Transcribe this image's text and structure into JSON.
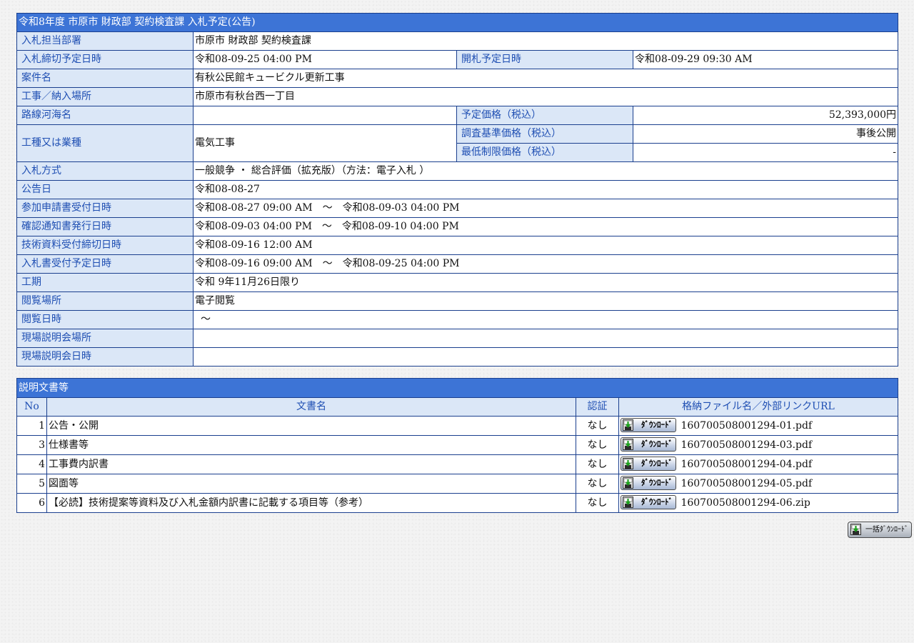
{
  "notice": {
    "title": "令和8年度 市原市 財政部 契約検査課 入札予定(公告)",
    "dept_label": "入札担当部署",
    "dept": "市原市 財政部 契約検査課",
    "deadline_label": "入札締切予定日時",
    "deadline": "令和08-09-25 04:00 PM",
    "opening_label": "開札予定日時",
    "opening": "令和08-09-29 09:30 AM",
    "case_label": "案件名",
    "case": "有秋公民館キュービクル更新工事",
    "place_label": "工事／納入場所",
    "place": "市原市有秋台西一丁目",
    "route_label": "路線河海名",
    "route": "",
    "price_label": "予定価格（税込）",
    "price": "52,393,000円",
    "type_label": "工種又は業種",
    "type": "電気工事",
    "survey_label": "調査基準価格（税込）",
    "survey": "事後公開",
    "min_label": "最低制限価格（税込）",
    "min": "-",
    "method_label": "入札方式",
    "method": "一般競争 ・ 総合評価（拡充版）（方法：電子入札 ）",
    "pubdate_label": "公告日",
    "pubdate": "令和08-08-27",
    "apply_label": "参加申請書受付日時",
    "apply": "令和08-08-27 09:00 AM　～　令和08-09-03 04:00 PM",
    "confirm_label": "確認通知書発行日時",
    "confirm": "令和08-09-03 04:00 PM　～　令和08-09-10 04:00 PM",
    "tech_label": "技術資料受付締切日時",
    "tech": "令和08-09-16 12:00 AM",
    "bidrecv_label": "入札書受付予定日時",
    "bidrecv": "令和08-09-16 09:00 AM　～　令和08-09-25 04:00 PM",
    "period_label": "工期",
    "period": "令和 9年11月26日限り",
    "view_place_label": "閲覧場所",
    "view_place": "電子閲覧",
    "view_date_label": "閲覧日時",
    "view_date": "～",
    "site_place_label": "現場説明会場所",
    "site_place": "",
    "site_date_label": "現場説明会日時",
    "site_date": ""
  },
  "docs": {
    "title": "説明文書等",
    "headers": {
      "no": "No",
      "name": "文書名",
      "auth": "認証",
      "file": "格納ファイル名／外部リンクURL"
    },
    "download_label": "ﾀﾞｳﾝﾛｰﾄﾞ",
    "rows": [
      {
        "no": "1",
        "name": "公告・公開",
        "auth": "なし",
        "file": "160700508001294-01.pdf"
      },
      {
        "no": "3",
        "name": "仕様書等",
        "auth": "なし",
        "file": "160700508001294-03.pdf"
      },
      {
        "no": "4",
        "name": "工事費内訳書",
        "auth": "なし",
        "file": "160700508001294-04.pdf"
      },
      {
        "no": "5",
        "name": "図面等",
        "auth": "なし",
        "file": "160700508001294-05.pdf"
      },
      {
        "no": "6",
        "name": "【必読】技術提案等資料及び入札金額内訳書に記載する項目等（参考）",
        "auth": "なし",
        "file": "160700508001294-06.zip"
      }
    ],
    "bulk_label": "一括ﾀﾞｳﾝﾛｰﾄﾞ"
  },
  "colors": {
    "header_bg": "#3d74d6",
    "label_bg": "#dbe7f7",
    "label_text": "#1f4fb3",
    "border": "#1a3f8e"
  },
  "icons": {
    "download": "floppy-disk-download-icon"
  }
}
